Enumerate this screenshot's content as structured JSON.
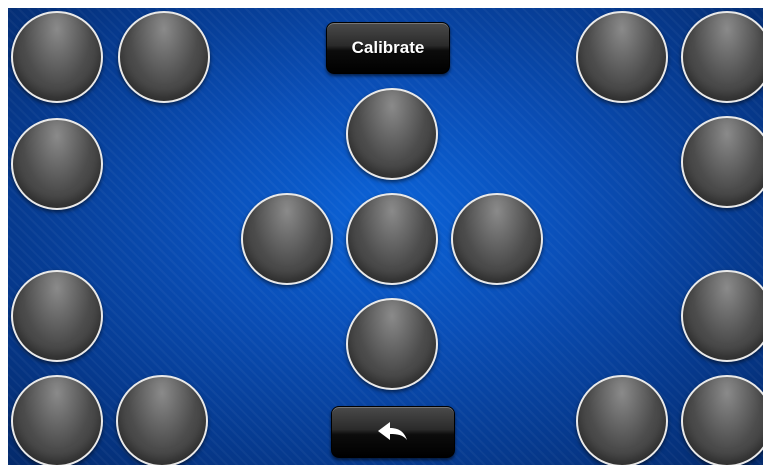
{
  "toolbar": {
    "calibrate_label": "Calibrate"
  },
  "icons": {
    "back": "back-arrow-icon"
  },
  "colors": {
    "background_center": "#0b63d8",
    "background_edge": "#042a6b",
    "button_fill": "#4c4c4c",
    "button_border": "#e9e9e9"
  }
}
